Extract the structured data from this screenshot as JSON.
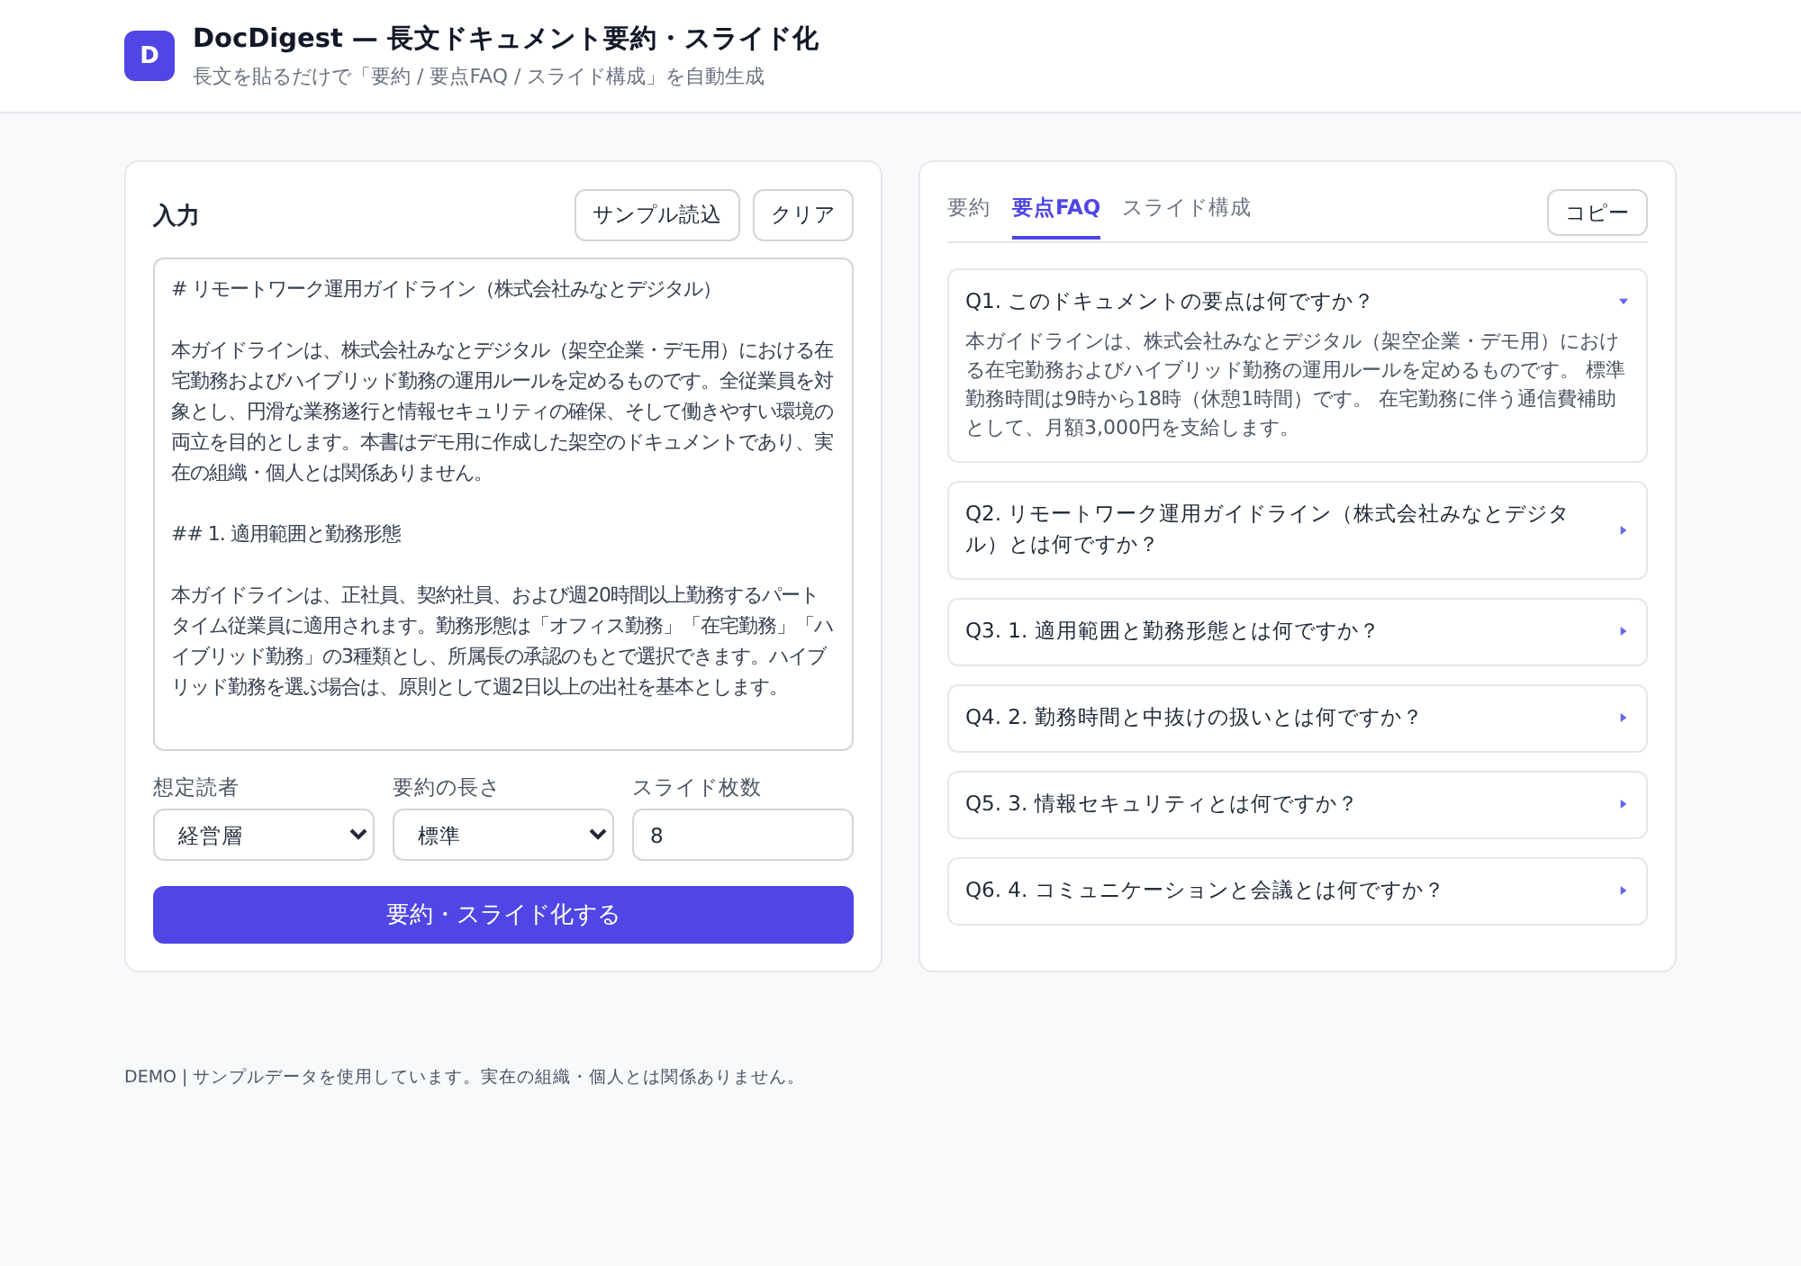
{
  "header": {
    "logo": "D",
    "title": "DocDigest — 長文ドキュメント要約・スライド化",
    "subtitle": "長文を貼るだけで「要約 / 要点FAQ / スライド構成」を自動生成"
  },
  "input_panel": {
    "title": "入力",
    "buttons": [
      "サンプル読込",
      "クリア"
    ],
    "document": [
      "# リモートワーク運用ガイドライン（株式会社みなとデジタル）",
      "本ガイドラインは、株式会社みなとデジタル（架空企業・デモ用）における在宅勤務およびハイブリッド勤務の運用ルールを定めるものです。全従業員を対象とし、円滑な業務遂行と情報セキュリティの確保、そして働きやすい環境の両立を目的とします。本書はデモ用に作成した架空のドキュメントであり、実在の組織・個人とは関係ありません。",
      "## 1. 適用範囲と勤務形態",
      "本ガイドラインは、正社員、契約社員、および週20時間以上勤務するパートタイム従業員に適用されます。勤務形態は「オフィス勤務」「在宅勤務」「ハイブリッド勤務」の3種類とし、所属長の承認のもとで選択できます。ハイブリッド勤務を選ぶ場合は、原則として週2日以上の出社を基本とします。"
    ],
    "fields": [
      {
        "kind": "select",
        "label": "想定読者",
        "value": "経営層"
      },
      {
        "kind": "select",
        "label": "要約の長さ",
        "value": "標準"
      },
      {
        "kind": "number",
        "label": "スライド枚数",
        "value": "8"
      }
    ],
    "submit": "要約・スライド化する"
  },
  "output_panel": {
    "tabs": [
      {
        "label": "要約",
        "selected": false
      },
      {
        "label": "要点FAQ",
        "selected": true
      },
      {
        "label": "スライド構成",
        "selected": false
      }
    ],
    "copy_button": "コピー",
    "faq": [
      {
        "question": "Q1. このドキュメントの要点は何ですか？",
        "expanded": true,
        "answer": "本ガイドラインは、株式会社みなとデジタル（架空企業・デモ用）における在宅勤務およびハイブリッド勤務の運用ルールを定めるものです。 標準勤務時間は9時から18時（休憩1時間）です。 在宅勤務に伴う通信費補助として、月額3,000円を支給します。"
      },
      {
        "question": "Q2. リモートワーク運用ガイドライン（株式会社みなとデジタル）とは何ですか？",
        "expanded": false
      },
      {
        "question": "Q3. 1. 適用範囲と勤務形態とは何ですか？",
        "expanded": false
      },
      {
        "question": "Q4. 2. 勤務時間と中抜けの扱いとは何ですか？",
        "expanded": false
      },
      {
        "question": "Q5. 3. 情報セキュリティとは何ですか？",
        "expanded": false
      },
      {
        "question": "Q6. 4. コミュニケーションと会議とは何ですか？",
        "expanded": false
      }
    ]
  },
  "footer": "DEMO | サンプルデータを使用しています。実在の組織・個人とは関係ありません。"
}
